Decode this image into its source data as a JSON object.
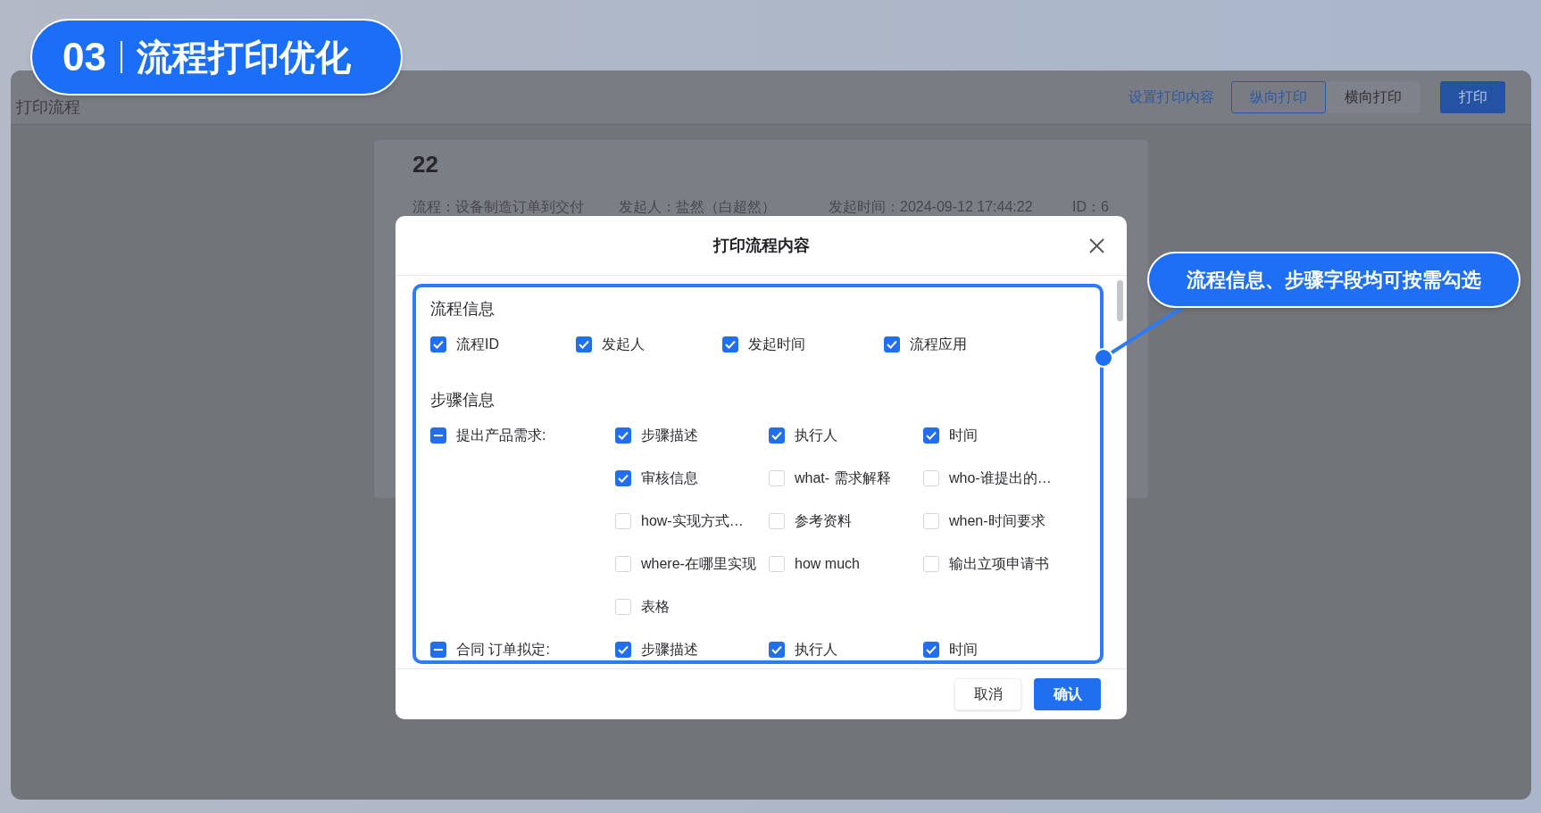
{
  "badge": {
    "number": "03",
    "title": "流程打印优化"
  },
  "page": {
    "title": "打印流程",
    "settings_link": "设置打印内容",
    "orientation_options": [
      {
        "label": "纵向打印",
        "selected": true
      },
      {
        "label": "横向打印",
        "selected": false
      }
    ],
    "print_button": "打印"
  },
  "document": {
    "number": "22",
    "meta": [
      "流程：设备制造订单到交付",
      "发起人：盐然（白超然）",
      "发起时间：2024-09-12 17:44:22",
      "ID：6"
    ]
  },
  "dialog": {
    "title": "打印流程内容",
    "process_section": {
      "title": "流程信息",
      "fields": [
        {
          "label": "流程ID",
          "checked": true
        },
        {
          "label": "发起人",
          "checked": true
        },
        {
          "label": "发起时间",
          "checked": true
        },
        {
          "label": "流程应用",
          "checked": true
        }
      ]
    },
    "steps_section": {
      "title": "步骤信息",
      "steps": [
        {
          "name": "提出产品需求:",
          "indeterminate": true,
          "fields": [
            {
              "label": "步骤描述",
              "checked": true
            },
            {
              "label": "执行人",
              "checked": true
            },
            {
              "label": "时间",
              "checked": true
            },
            {
              "label": "审核信息",
              "checked": true
            },
            {
              "label": "what- 需求解释",
              "checked": false
            },
            {
              "label": "who-谁提出的…",
              "checked": false
            },
            {
              "label": "how-实现方式…",
              "checked": false
            },
            {
              "label": "参考资料",
              "checked": false
            },
            {
              "label": "when-时间要求",
              "checked": false
            },
            {
              "label": "where-在哪里实现",
              "checked": false
            },
            {
              "label": "how much",
              "checked": false
            },
            {
              "label": "输出立项申请书",
              "checked": false
            },
            {
              "label": "表格",
              "checked": false
            }
          ]
        },
        {
          "name": "合同 订单拟定:",
          "indeterminate": true,
          "fields": [
            {
              "label": "步骤描述",
              "checked": true
            },
            {
              "label": "执行人",
              "checked": true
            },
            {
              "label": "时间",
              "checked": true
            }
          ]
        }
      ]
    },
    "buttons": [
      {
        "label": "取消",
        "kind": "default"
      },
      {
        "label": "确认",
        "kind": "primary"
      }
    ]
  },
  "callout": {
    "text": "流程信息、步骤字段均可按需勾选"
  }
}
